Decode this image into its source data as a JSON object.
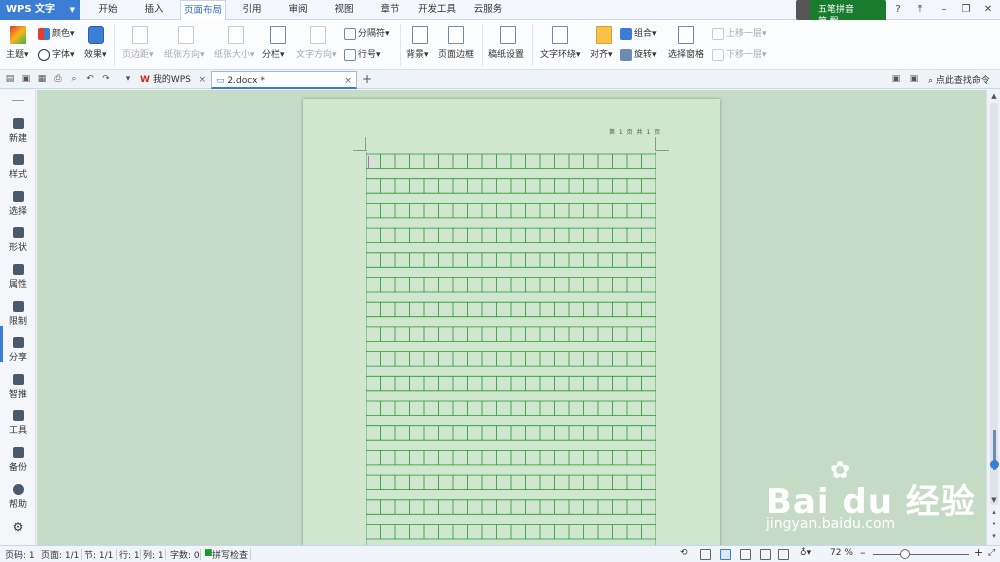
{
  "app": {
    "title": "WPS 文字",
    "menu_tabs": [
      "开始",
      "插入",
      "页面布局",
      "引用",
      "审阅",
      "视图",
      "章节",
      "开发工具",
      "云服务"
    ],
    "active_tab": "页面布局"
  },
  "ime": {
    "name": "五笔拼音",
    "mode": "简 飘"
  },
  "ribbon": {
    "theme": "主题",
    "color": "颜色",
    "font": "字体",
    "effect": "效果",
    "margins": "页边距",
    "orientation": "纸张方向",
    "size": "纸张大小",
    "columns": "分栏",
    "text_direction": "文字方向",
    "separator": "分隔符",
    "line_number": "行号",
    "background": "背景",
    "page_border": "页面边框",
    "manuscript": "稿纸设置",
    "wrap": "文字环绕",
    "align": "对齐",
    "group": "组合",
    "rotate": "旋转",
    "selection_pane": "选择窗格",
    "bring_forward": "上移一层",
    "send_backward": "下移一层"
  },
  "tabs": {
    "home": "我的WPS",
    "doc": "2.docx *"
  },
  "find_command": "点此查找命令",
  "sidebar": {
    "items": [
      "新建",
      "样式",
      "选择",
      "形状",
      "属性",
      "限制",
      "分享",
      "智推",
      "工具",
      "备份",
      "帮助"
    ]
  },
  "document": {
    "header": "第 1 页 共 1 页",
    "grid_rows": 17,
    "grid_cols": 20,
    "grid_color": "#1f9a2c",
    "page_color": "#d1e6cf"
  },
  "status": {
    "page_no": "页码: 1",
    "pages": "页面: 1/1",
    "section": "节: 1/1",
    "row": "行: 1",
    "col": "列: 1",
    "words": "字数: 0",
    "spell": "拼写检查",
    "zoom": "72 %"
  },
  "watermark": {
    "logo": "Bai du 经验",
    "url": "jingyan.baidu.com"
  },
  "colors": {
    "accent": "#3c7ed6",
    "ime_bg": "#197b2e"
  }
}
